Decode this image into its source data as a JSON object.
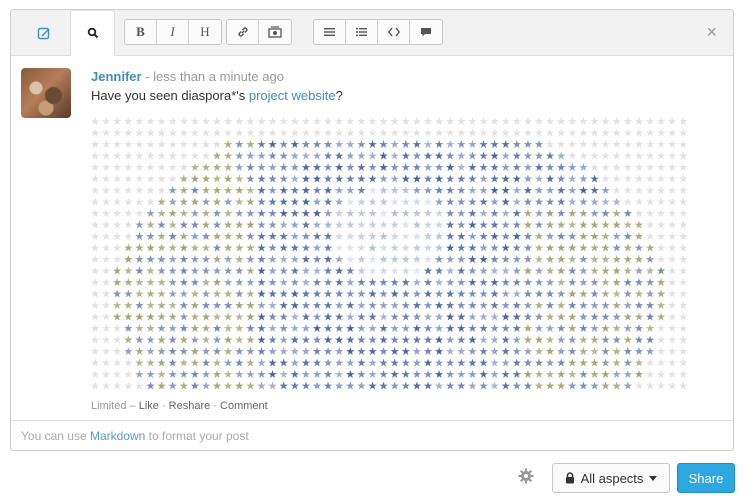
{
  "toolbar": {
    "tabs": [
      {
        "id": "write",
        "icon": "pencil-icon"
      },
      {
        "id": "preview",
        "icon": "search-icon",
        "active": true
      }
    ],
    "format_buttons": {
      "bold": "B",
      "italic": "I",
      "heading": "H"
    },
    "close": "×"
  },
  "post": {
    "author": "Jennifer",
    "time": " - less than a minute ago",
    "text_before": "Have you seen diaspora*'s ",
    "link_text": "project website",
    "text_after": "?",
    "interactions": {
      "scope": "Limited",
      "sep": " – ",
      "like": "Like",
      "dot1": " · ",
      "reshare": "Reshare",
      "dot2": " · ",
      "comment": "Comment"
    }
  },
  "footer": {
    "hint_before": "You can use ",
    "hint_link": "Markdown",
    "hint_after": " to format your post"
  },
  "controls": {
    "aspects_label": "All aspects",
    "share_label": "Share"
  },
  "colors": {
    "link": "#3f8fba",
    "share_button": "#2ea6e0",
    "star_blue": "#3b5a9a",
    "star_olive": "#9aa06a",
    "star_gray": "#e2e2e2"
  }
}
